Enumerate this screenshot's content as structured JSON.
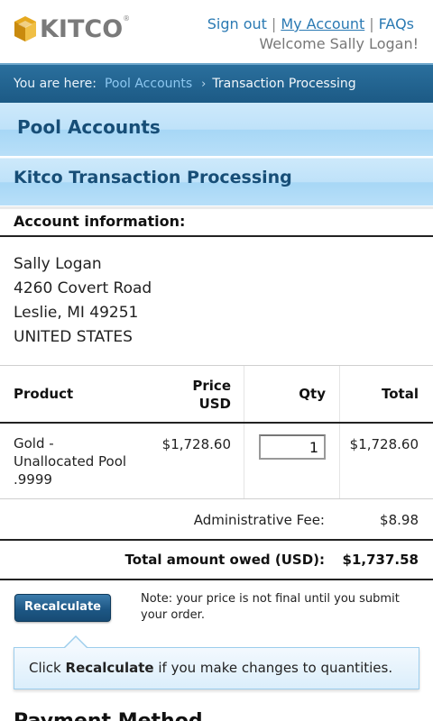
{
  "header": {
    "logo_text": "KITCO",
    "logo_reg": "®",
    "links": {
      "sign_out": "Sign out",
      "my_account": "My Account",
      "faqs": "FAQs",
      "separator": "|"
    },
    "welcome": "Welcome Sally Logan!"
  },
  "breadcrumb": {
    "prefix": "You are here:",
    "link": "Pool Accounts",
    "arrow": "›",
    "current": "Transaction Processing"
  },
  "sections": {
    "pool_accounts": "Pool Accounts",
    "transaction_processing": "Kitco Transaction Processing"
  },
  "account": {
    "heading": "Account information:",
    "address_lines": [
      "Sally Logan",
      "4260 Covert Road",
      "Leslie, MI 49251",
      "UNITED STATES"
    ]
  },
  "table": {
    "headers": {
      "product": "Product",
      "price_line1": "Price",
      "price_line2": "USD",
      "qty": "Qty",
      "total": "Total"
    },
    "row": {
      "product_lines": [
        "Gold -",
        "Unallocated Pool",
        ".9999"
      ],
      "price": "$1,728.60",
      "qty": "1",
      "total": "$1,728.60"
    },
    "fee_label": "Administrative Fee:",
    "fee_value": "$8.98",
    "owed_label": "Total amount owed (USD):",
    "owed_value": "$1,737.58"
  },
  "actions": {
    "recalculate_label": "Recalculate",
    "note": "Note: your price is not final until you submit your order."
  },
  "tooltip": {
    "pre": "Click ",
    "bold": "Recalculate",
    "post": " if you make changes to quantities."
  },
  "payment_heading": "Payment Method",
  "colors": {
    "link": "#2b7ab3",
    "breadcrumb_bg": "#1c5a85",
    "section_bg": "#bfe2f9",
    "section_text": "#174e77",
    "button_bg": "#1d5785",
    "logo_gold": "#e6a91f"
  }
}
